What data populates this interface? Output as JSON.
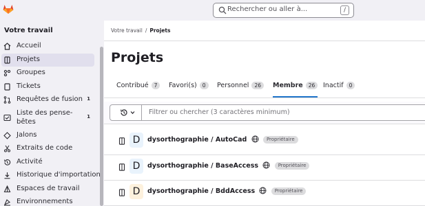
{
  "topbar": {
    "search_placeholder": "Rechercher ou aller à...",
    "search_shortcut": "/"
  },
  "sidebar": {
    "title": "Votre travail",
    "items": [
      {
        "label": "Accueil",
        "icon": "home-icon",
        "count": ""
      },
      {
        "label": "Projets",
        "icon": "project-icon",
        "count": "",
        "active": true
      },
      {
        "label": "Groupes",
        "icon": "group-icon",
        "count": ""
      },
      {
        "label": "Tickets",
        "icon": "issues-icon",
        "count": ""
      },
      {
        "label": "Requêtes de fusion",
        "icon": "merge-request-icon",
        "count": "1"
      },
      {
        "label": "Liste des pense-bêtes",
        "icon": "todo-icon",
        "count": "1"
      },
      {
        "label": "Jalons",
        "icon": "milestone-icon",
        "count": ""
      },
      {
        "label": "Extraits de code",
        "icon": "snippet-icon",
        "count": ""
      },
      {
        "label": "Activité",
        "icon": "history-icon",
        "count": ""
      },
      {
        "label": "Historique d'importation",
        "icon": "import-icon",
        "count": ""
      },
      {
        "label": "Espaces de travail",
        "icon": "workspace-icon",
        "count": ""
      },
      {
        "label": "Environnements",
        "icon": "environment-icon",
        "count": ""
      }
    ]
  },
  "breadcrumb": {
    "parent": "Votre travail",
    "separator": "/",
    "current": "Projets"
  },
  "page": {
    "title": "Projets"
  },
  "tabs": [
    {
      "label": "Contribué",
      "count": "7",
      "active": false
    },
    {
      "label": "Favori(s)",
      "count": "0",
      "active": false
    },
    {
      "label": "Personnel",
      "count": "26",
      "active": false
    },
    {
      "label": "Membre",
      "count": "26",
      "active": true
    },
    {
      "label": "Inactif",
      "count": "0",
      "active": false
    }
  ],
  "filter": {
    "placeholder": "Filtrer ou chercher (3 caractères minimum)"
  },
  "projects": [
    {
      "avatar_letter": "D",
      "name": "dysorthographie / AutoCad",
      "visibility_icon": "globe-icon",
      "role": "Propriétaire",
      "avatar_color": "#e9f3fc"
    },
    {
      "avatar_letter": "D",
      "name": "dysorthographie / BaseAccess",
      "visibility_icon": "globe-icon",
      "role": "Propriétaire",
      "avatar_color": "#e9f3fc"
    },
    {
      "avatar_letter": "D",
      "name": "dysorthographie / BddAccess",
      "visibility_icon": "globe-icon",
      "role": "Propriétaire",
      "avatar_color": "#fdf1dd"
    }
  ],
  "colors": {
    "accent": "#1f75cb",
    "sidebar_bg": "#f1f0f5",
    "sidebar_active": "#e1dfed"
  }
}
